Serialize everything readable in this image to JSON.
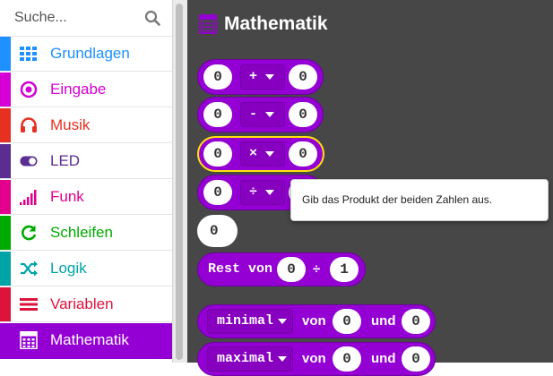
{
  "search": {
    "placeholder": "Suche..."
  },
  "categories": [
    {
      "label": "Grundlagen",
      "color": "#1e90ff",
      "icon": "grid-icon"
    },
    {
      "label": "Eingabe",
      "color": "#d400d4",
      "icon": "target-icon"
    },
    {
      "label": "Musik",
      "color": "#e63022",
      "icon": "headphones-icon"
    },
    {
      "label": "LED",
      "color": "#5c2d91",
      "icon": "toggle-icon"
    },
    {
      "label": "Funk",
      "color": "#e3008c",
      "icon": "signal-bars-icon"
    },
    {
      "label": "Schleifen",
      "color": "#00aa00",
      "icon": "refresh-icon"
    },
    {
      "label": "Logik",
      "color": "#00a4a6",
      "icon": "shuffle-icon"
    },
    {
      "label": "Variablen",
      "color": "#dc143c",
      "icon": "lines-icon"
    },
    {
      "label": "Mathematik",
      "color": "#9400d3",
      "icon": "calculator-icon"
    }
  ],
  "flyout": {
    "title": "Mathematik",
    "blocks": {
      "add": {
        "left": "0",
        "op": "+",
        "right": "0"
      },
      "sub": {
        "left": "0",
        "op": "-",
        "right": "0"
      },
      "mul": {
        "left": "0",
        "op": "×",
        "right": "0"
      },
      "div": {
        "left": "0",
        "op": "÷",
        "right": "0"
      },
      "number": "0",
      "rest": {
        "label": "Rest von",
        "left": "0",
        "op": "÷",
        "right": "1"
      },
      "minimal": {
        "fn": "minimal",
        "von": "von",
        "left": "0",
        "und": "und",
        "right": "0"
      },
      "maximal": {
        "fn": "maximal",
        "von": "von",
        "left": "0",
        "und": "und",
        "right": "0"
      }
    }
  },
  "tooltip": "Gib das Produkt der beiden Zahlen aus.",
  "colors": {
    "math": "#9400d3",
    "flyout_bg": "#474747",
    "highlight": "#ffe30a"
  }
}
